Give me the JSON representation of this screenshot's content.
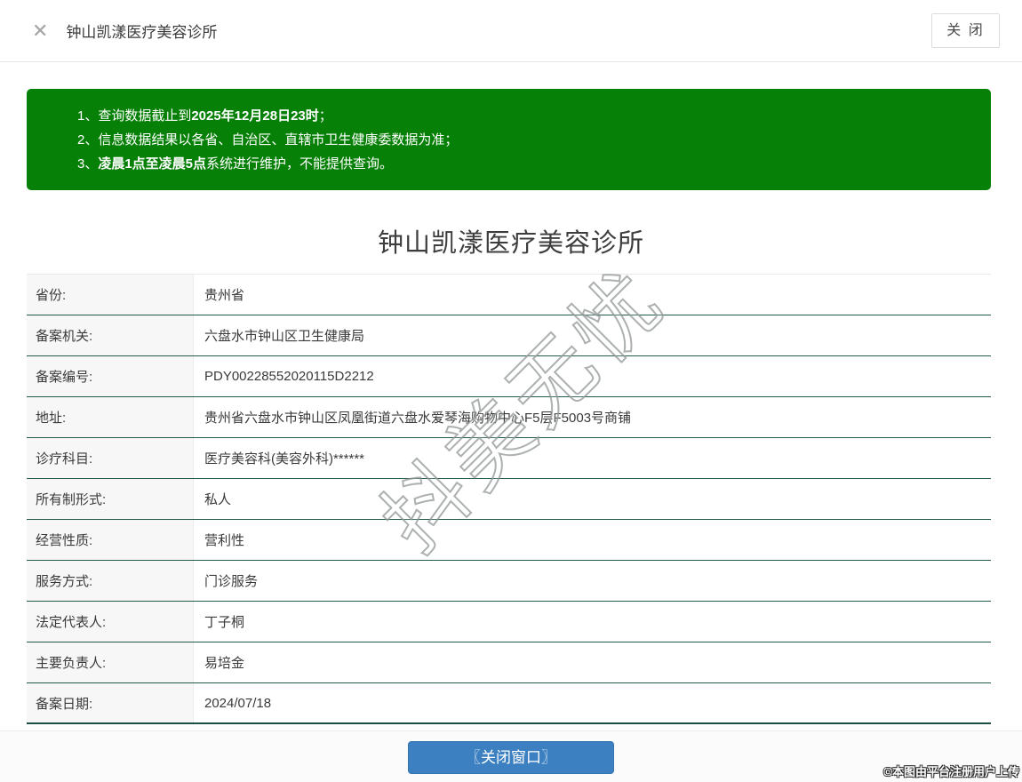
{
  "header": {
    "close_icon": "✕",
    "title": "钟山凯漾医疗美容诊所",
    "close_button_label": "关 闭"
  },
  "notice": {
    "lines": [
      [
        {
          "text": "1、查询数据截止到",
          "bold": false
        },
        {
          "text": "2025年12月28日23时",
          "bold": true
        },
        {
          "text": "；",
          "bold": false
        }
      ],
      [
        {
          "text": "2、信息数据结果以各省、自治区、直辖市卫生健康委数据为准；",
          "bold": false
        }
      ],
      [
        {
          "text": "3、",
          "bold": false
        },
        {
          "text": "凌晨1点至凌晨5点",
          "bold": true
        },
        {
          "text": "系统进行维护，不能提供查询。",
          "bold": false
        }
      ]
    ]
  },
  "main": {
    "title": "钟山凯漾医疗美容诊所"
  },
  "info": {
    "rows": [
      {
        "label": "省份:",
        "value": "贵州省"
      },
      {
        "label": "备案机关:",
        "value": "六盘水市钟山区卫生健康局"
      },
      {
        "label": "备案编号:",
        "value": "PDY00228552020115D2212"
      },
      {
        "label": "地址:",
        "value": "贵州省六盘水市钟山区凤凰街道六盘水爱琴海购物中心F5层F5003号商铺"
      },
      {
        "label": "诊疗科目:",
        "value": "医疗美容科(美容外科)******"
      },
      {
        "label": "所有制形式:",
        "value": "私人"
      },
      {
        "label": "经营性质:",
        "value": "营利性"
      },
      {
        "label": "服务方式:",
        "value": "门诊服务"
      },
      {
        "label": "法定代表人:",
        "value": "丁子桐"
      },
      {
        "label": "主要负责人:",
        "value": "易培金"
      },
      {
        "label": "备案日期:",
        "value": "2024/07/18"
      }
    ]
  },
  "footer": {
    "close_window_button_label": "〖关闭窗口〗"
  },
  "watermark_text": "抖美无忧",
  "credit_text": "©本图由平台注册用户上传",
  "colors": {
    "notice_green": "#078007",
    "table_divider_teal": "#235a4e",
    "button_blue": "#3c80c1"
  }
}
